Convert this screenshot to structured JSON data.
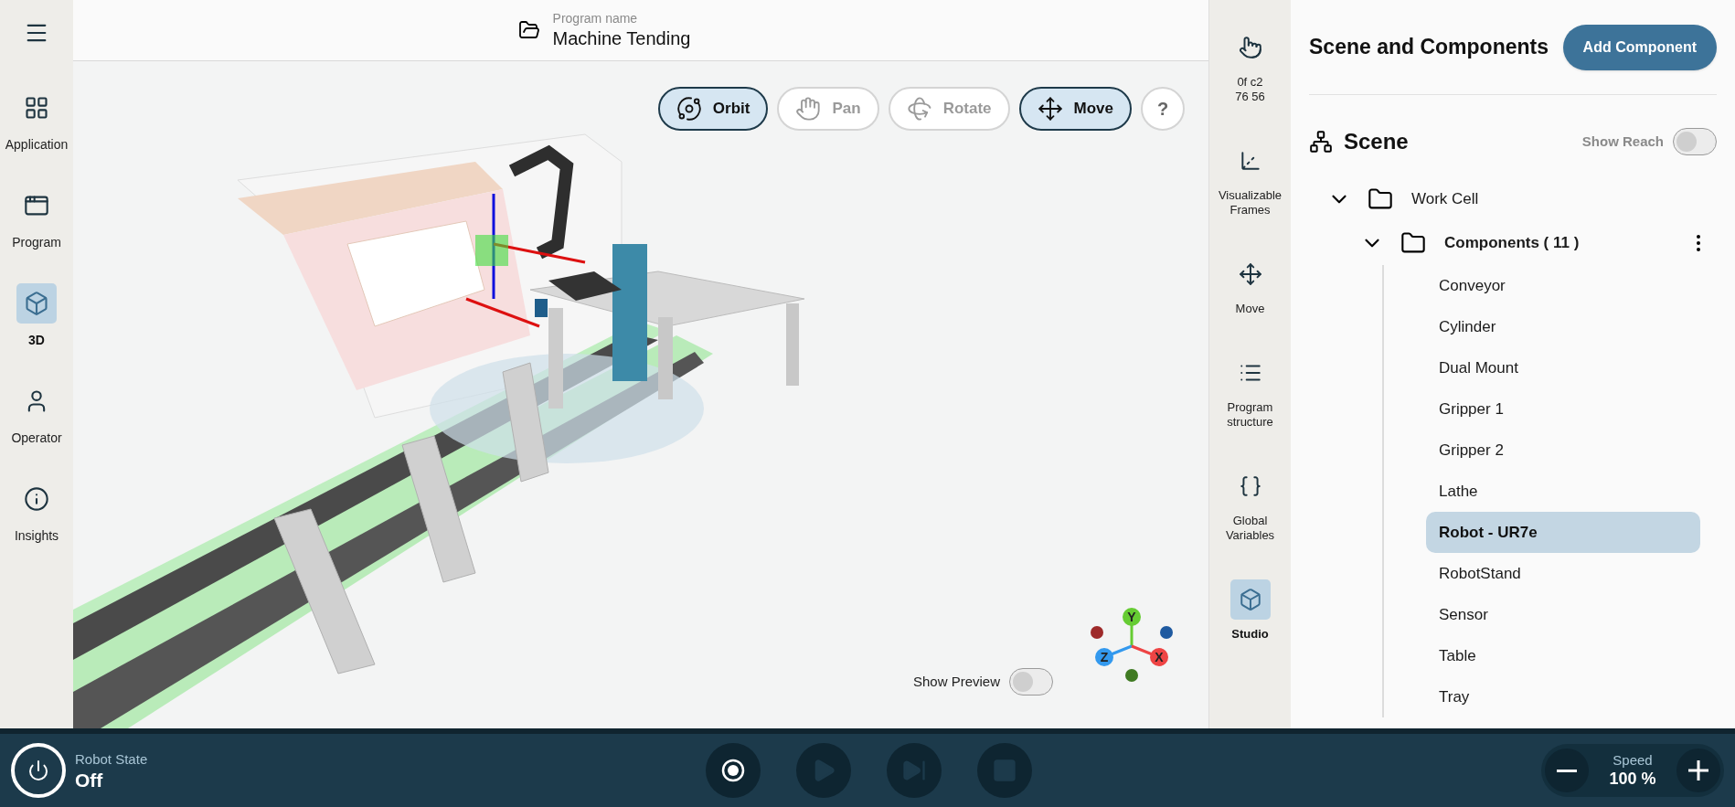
{
  "nav": {
    "items": [
      {
        "label": "Application",
        "kind": "grid",
        "selected": false
      },
      {
        "label": "Program",
        "kind": "window",
        "selected": false
      },
      {
        "label": "3D",
        "kind": "cube",
        "selected": true
      },
      {
        "label": "Operator",
        "kind": "user",
        "selected": false
      },
      {
        "label": "Insights",
        "kind": "info",
        "selected": false
      }
    ]
  },
  "header": {
    "caption": "Program name",
    "title": "Machine Tending"
  },
  "view_tools": [
    {
      "label": "Orbit",
      "kind": "orbit",
      "selected": true,
      "disabled": false
    },
    {
      "label": "Pan",
      "kind": "hand",
      "selected": false,
      "disabled": true
    },
    {
      "label": "Rotate",
      "kind": "rotate",
      "selected": false,
      "disabled": true
    },
    {
      "label": "Move",
      "kind": "move",
      "selected": true,
      "disabled": false
    }
  ],
  "help": "?",
  "show_preview": {
    "label": "Show Preview",
    "on": false
  },
  "gizmo": {
    "axes": [
      {
        "label": "Y",
        "color": "#66cc33"
      },
      {
        "label": "Z",
        "color": "#3399ee"
      },
      {
        "label": "X",
        "color": "#ee4444"
      }
    ],
    "dots": [
      {
        "color": "#9e2a2a"
      },
      {
        "color": "#1f5aa0"
      },
      {
        "color": "#3f7a22"
      }
    ]
  },
  "tool_rail": [
    {
      "label": "0f c2\n76 56",
      "kind": "pointer",
      "selected": false
    },
    {
      "label": "Visualizable Frames",
      "kind": "frames",
      "selected": false
    },
    {
      "label": "Move",
      "kind": "move",
      "selected": false
    },
    {
      "label": "Program structure",
      "kind": "list",
      "selected": false
    },
    {
      "label": "Global Variables",
      "kind": "variable",
      "selected": false
    },
    {
      "label": "Studio",
      "kind": "studio",
      "selected": true
    }
  ],
  "panel": {
    "title": "Scene and Components",
    "add_button": "Add Component",
    "scene": {
      "title": "Scene",
      "show_reach": {
        "label": "Show Reach",
        "on": false
      },
      "tree": [
        {
          "label": "Work Cell",
          "expanded": true,
          "children": [
            {
              "label": "Components ( 11 )",
              "expanded": true,
              "children": [
                {
                  "label": "Conveyor",
                  "selected": false
                },
                {
                  "label": "Cylinder",
                  "selected": false
                },
                {
                  "label": "Dual Mount",
                  "selected": false
                },
                {
                  "label": "Gripper 1",
                  "selected": false
                },
                {
                  "label": "Gripper 2",
                  "selected": false
                },
                {
                  "label": "Lathe",
                  "selected": false
                },
                {
                  "label": "Robot - UR7e",
                  "selected": true
                },
                {
                  "label": "RobotStand",
                  "selected": false
                },
                {
                  "label": "Sensor",
                  "selected": false
                },
                {
                  "label": "Table",
                  "selected": false
                },
                {
                  "label": "Tray",
                  "selected": false
                }
              ]
            }
          ]
        }
      ]
    }
  },
  "status_bar": {
    "state_label": "Robot State",
    "state_value": "Off",
    "controls": [
      {
        "kind": "record",
        "disabled": false
      },
      {
        "kind": "play",
        "disabled": true
      },
      {
        "kind": "step",
        "disabled": true
      },
      {
        "kind": "stop",
        "disabled": true
      }
    ],
    "speed": {
      "label": "Speed",
      "value": "100 %"
    }
  }
}
